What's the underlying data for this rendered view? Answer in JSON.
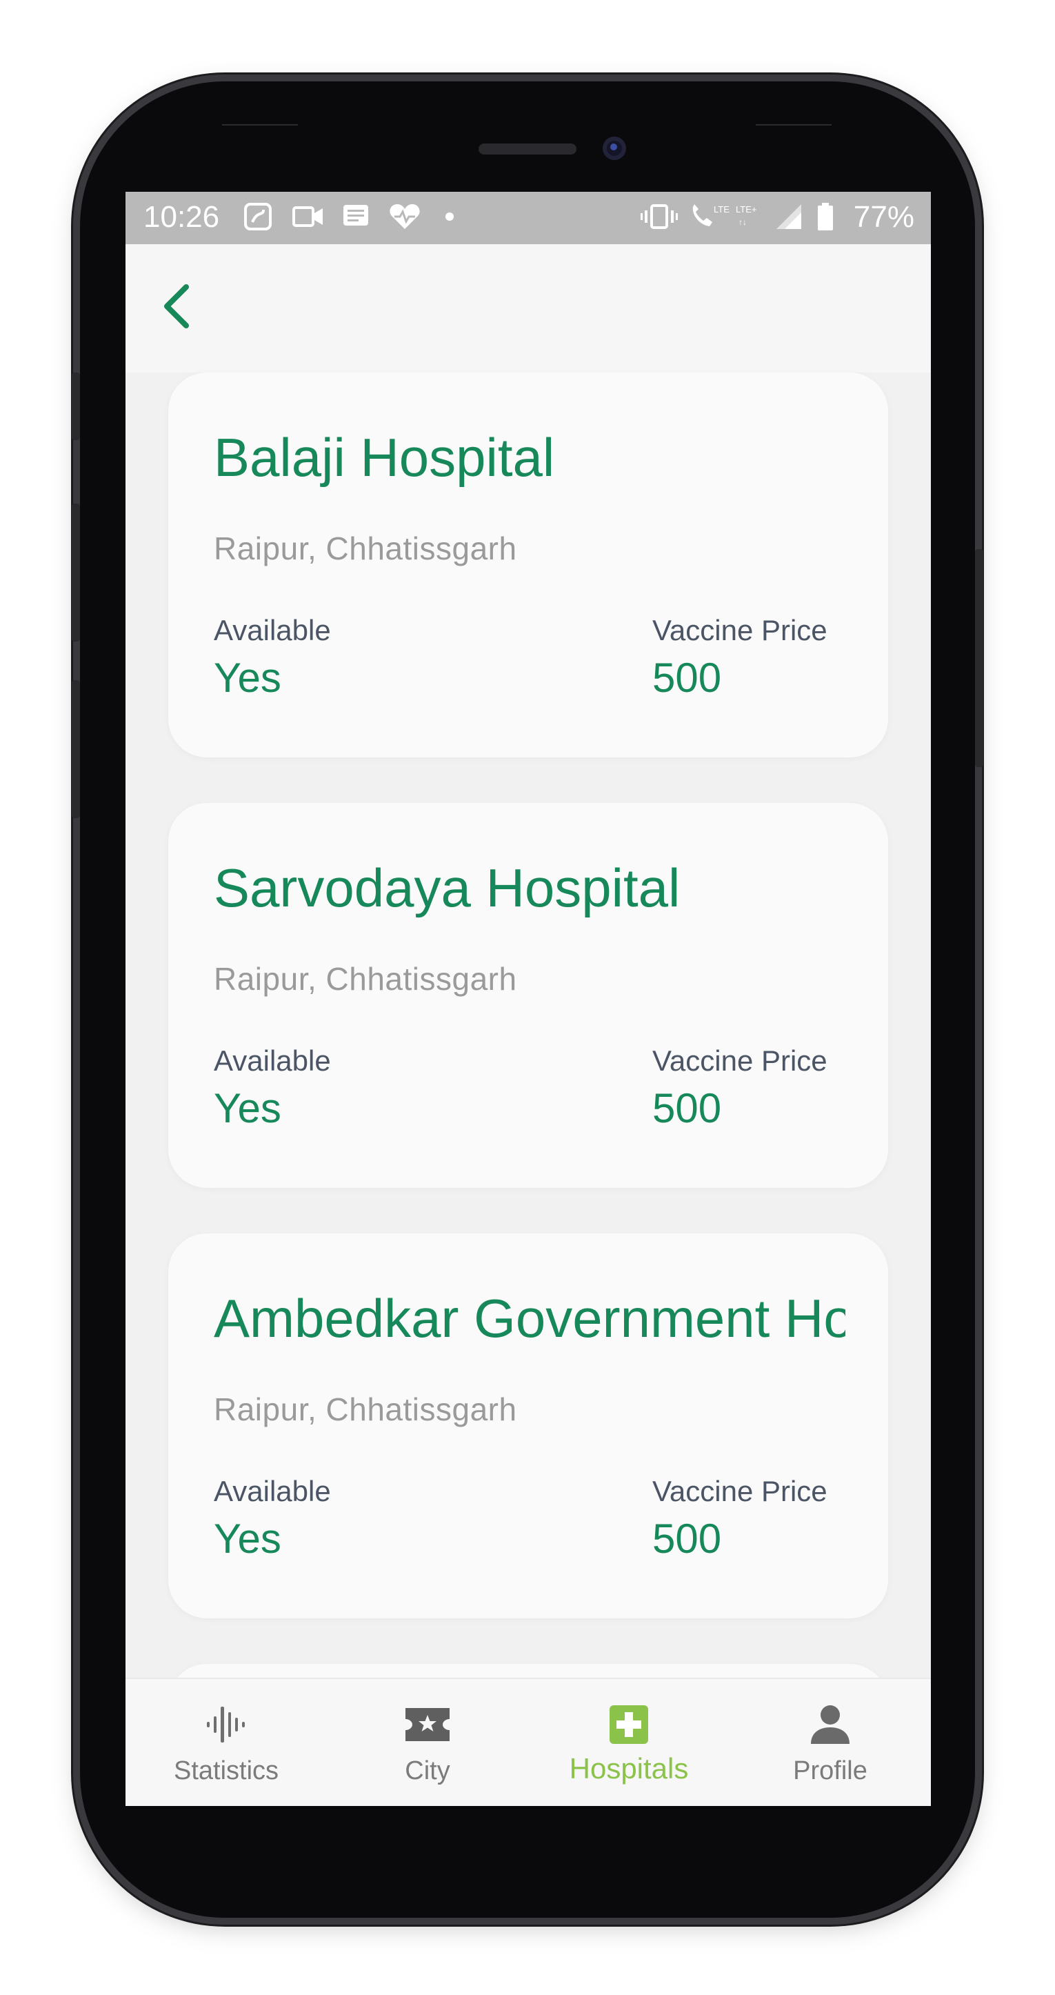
{
  "status_bar": {
    "time": "10:26",
    "battery": "77%"
  },
  "header": {
    "back_icon": "chevron-left-icon"
  },
  "hospitals": [
    {
      "name": "Balaji Hospital",
      "location": "Raipur, Chhatissgarh",
      "available_label": "Available",
      "available_value": "Yes",
      "price_label": "Vaccine Price",
      "price_value": "500"
    },
    {
      "name": "Sarvodaya Hospital",
      "location": "Raipur, Chhatissgarh",
      "available_label": "Available",
      "available_value": "Yes",
      "price_label": "Vaccine Price",
      "price_value": "500"
    },
    {
      "name": "Ambedkar Government Ho",
      "location": "Raipur, Chhatissgarh",
      "available_label": "Available",
      "available_value": "Yes",
      "price_label": "Vaccine Price",
      "price_value": "500"
    }
  ],
  "bottom_nav": [
    {
      "label": "Statistics",
      "icon": "waveform-icon",
      "active": false
    },
    {
      "label": "City",
      "icon": "ticket-star-icon",
      "active": false
    },
    {
      "label": "Hospitals",
      "icon": "hospital-plus-icon",
      "active": true
    },
    {
      "label": "Profile",
      "icon": "person-icon",
      "active": false
    }
  ],
  "colors": {
    "accent_green": "#17885a",
    "nav_active": "#8bc34a",
    "status_bar_bg": "#b9b9b9"
  }
}
